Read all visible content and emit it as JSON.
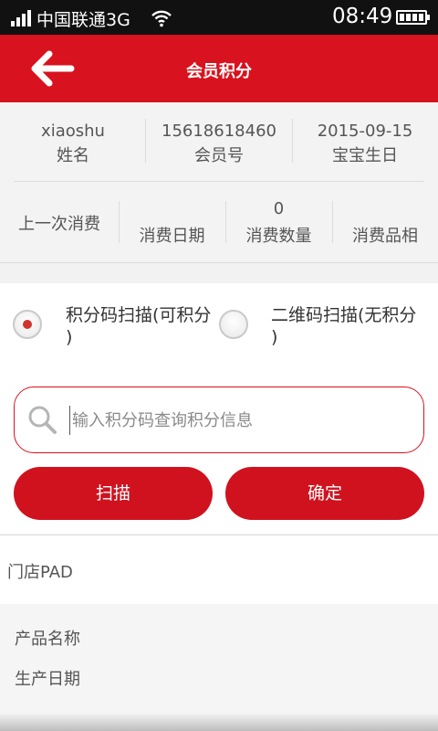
{
  "status_bar": {
    "carrier": "中国联通3G",
    "time": "08:49",
    "icons": [
      "signal-icon",
      "wifi-icon",
      "battery-icon"
    ]
  },
  "header": {
    "title": "会员积分",
    "back_icon": "back-arrow-icon"
  },
  "member": {
    "name_value": "xiaoshu",
    "name_label": "姓名",
    "id_value": "15618618460",
    "id_label": "会员号",
    "birthday_value": "2015-09-15",
    "birthday_label": "宝宝生日"
  },
  "last_purchase": {
    "label": "上一次消费",
    "date_label": "消费日期",
    "quantity_value": "0",
    "quantity_label": "消费数量",
    "category_label": "消费品相"
  },
  "scan_options": {
    "option1_line1": "积分码扫描(可积分",
    "option1_line2": ")",
    "option2_line1": "二维码扫描(无积分",
    "option2_line2": ")",
    "selected": "option1"
  },
  "search": {
    "value": "",
    "placeholder": "输入积分码查询积分信息"
  },
  "buttons": {
    "scan_label": "扫描",
    "confirm_label": "确定"
  },
  "store": {
    "label": "门店PAD"
  },
  "product": {
    "name_label": "产品名称",
    "date_label": "生产日期"
  },
  "colors": {
    "brand_red": "#d8121e",
    "status_bar": "#111111"
  }
}
